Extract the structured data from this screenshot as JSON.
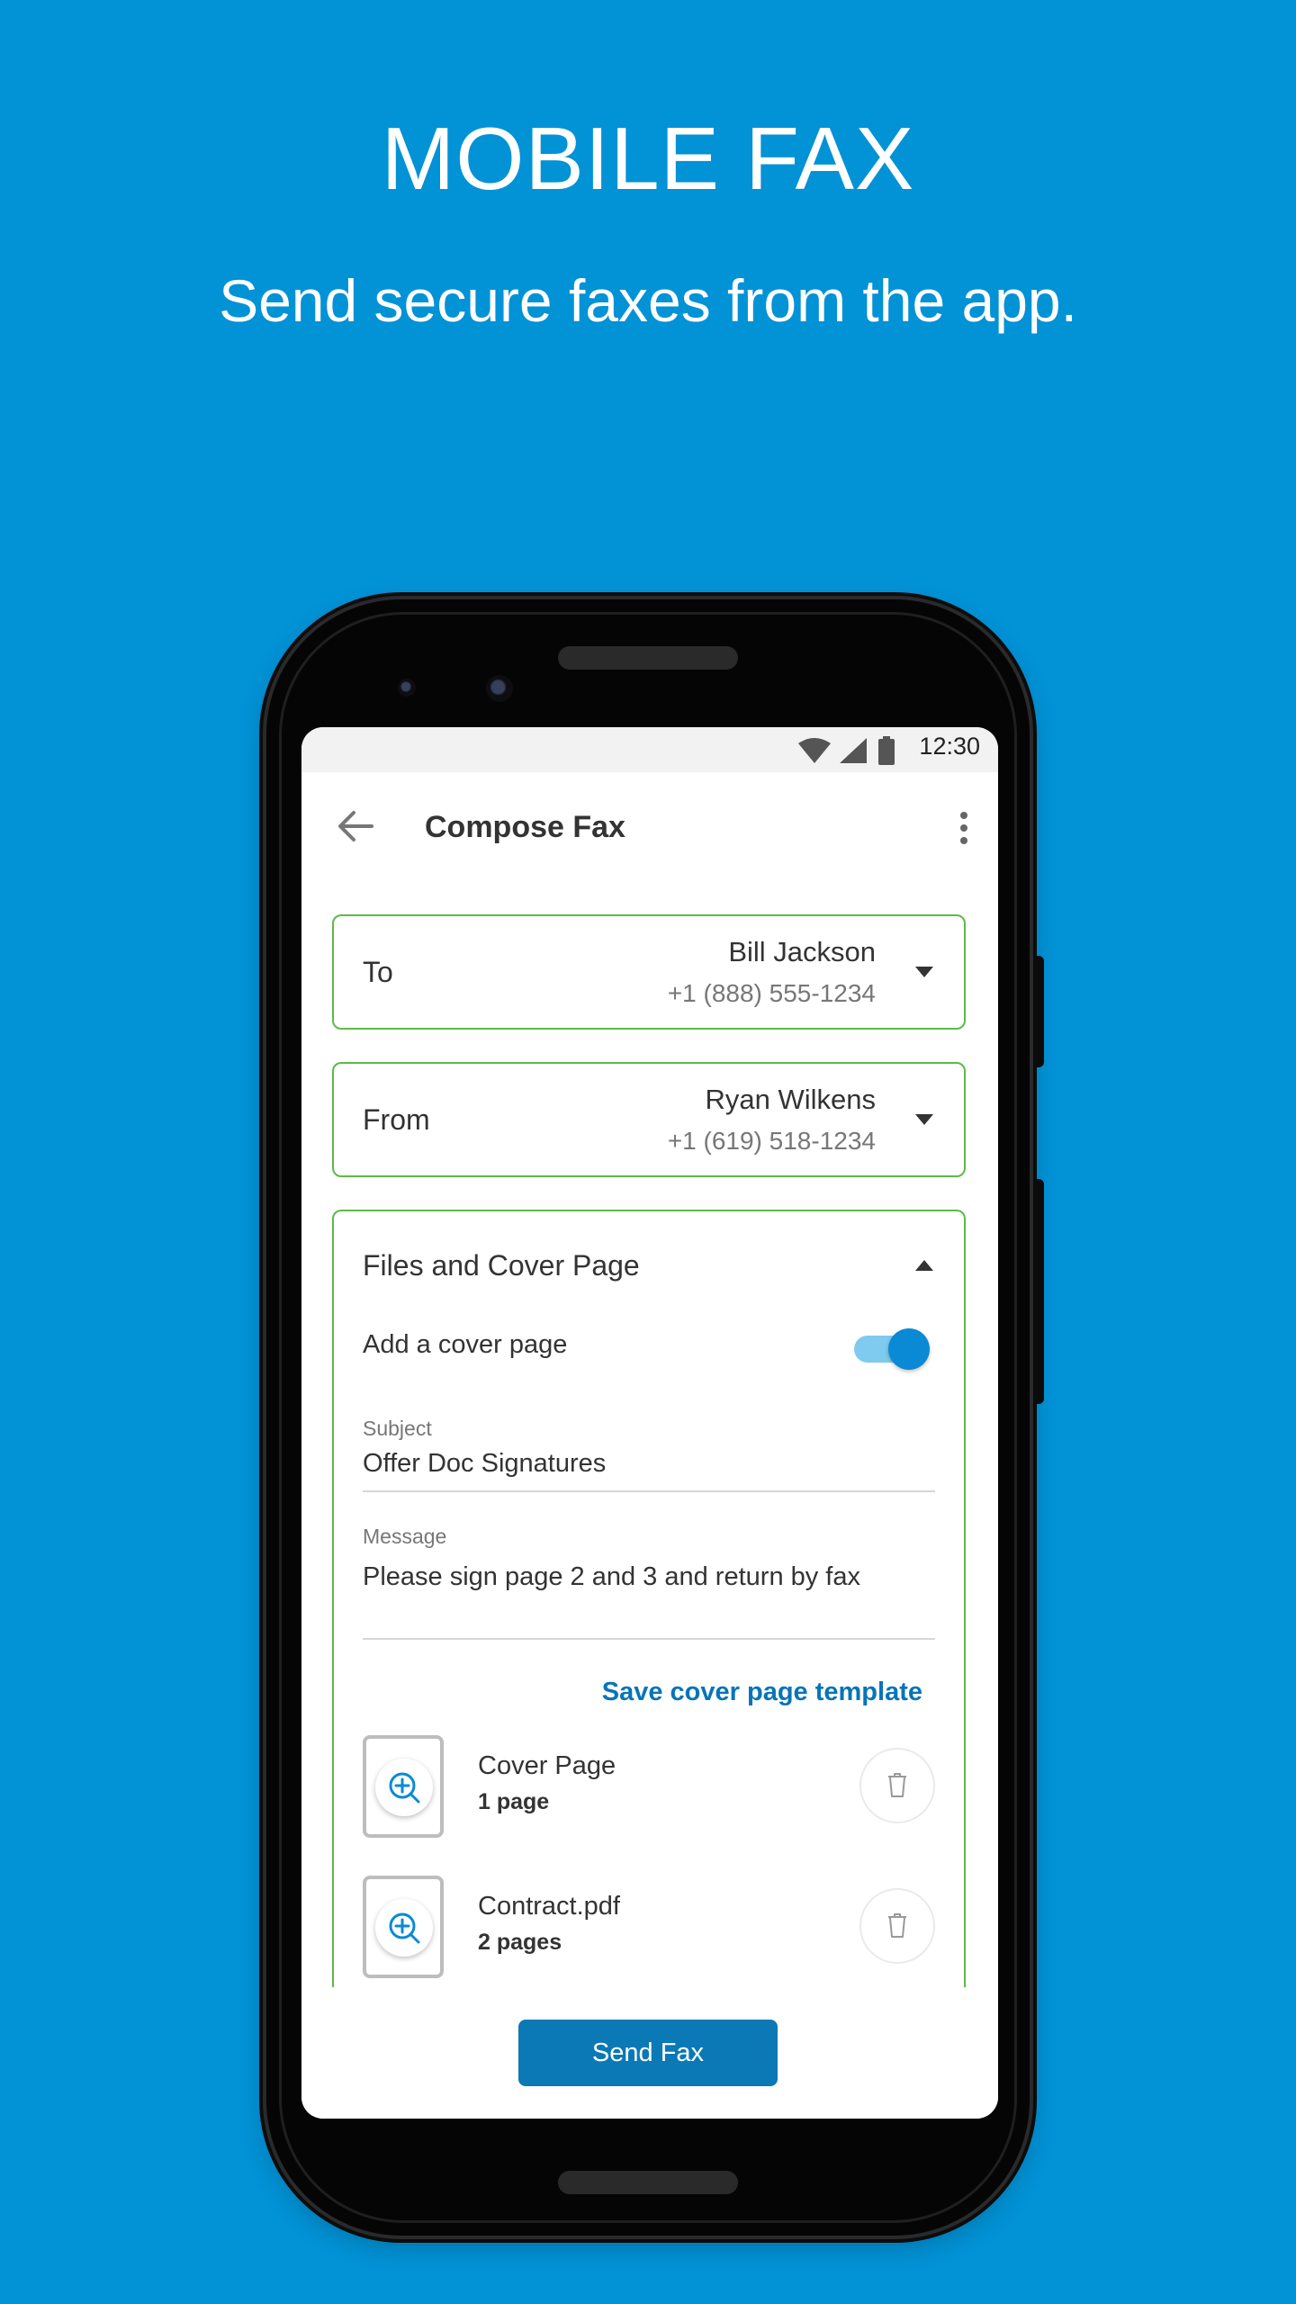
{
  "promo": {
    "headline": "MOBILE FAX",
    "subheadline": "Send secure faxes from the app."
  },
  "statusbar": {
    "time": "12:30"
  },
  "appbar": {
    "title": "Compose Fax"
  },
  "to": {
    "label": "To",
    "name": "Bill Jackson",
    "number": "+1 (888) 555-1234"
  },
  "from": {
    "label": "From",
    "name": "Ryan Wilkens",
    "number": "+1 (619) 518-1234"
  },
  "files_section": {
    "title": "Files and Cover Page",
    "cover_toggle_label": "Add a cover page",
    "cover_toggle_on": true,
    "subject_label": "Subject",
    "subject_value": "Offer Doc Signatures",
    "message_label": "Message",
    "message_value": "Please sign page 2 and 3 and return by fax",
    "save_template_link": "Save cover page template",
    "files": [
      {
        "name": "Cover Page",
        "pages": "1 page"
      },
      {
        "name": "Contract.pdf",
        "pages": "2 pages"
      }
    ]
  },
  "send_button": "Send Fax",
  "colors": {
    "background": "#0292d6",
    "accent": "#0a79b6",
    "card_border": "#5cbb47"
  }
}
